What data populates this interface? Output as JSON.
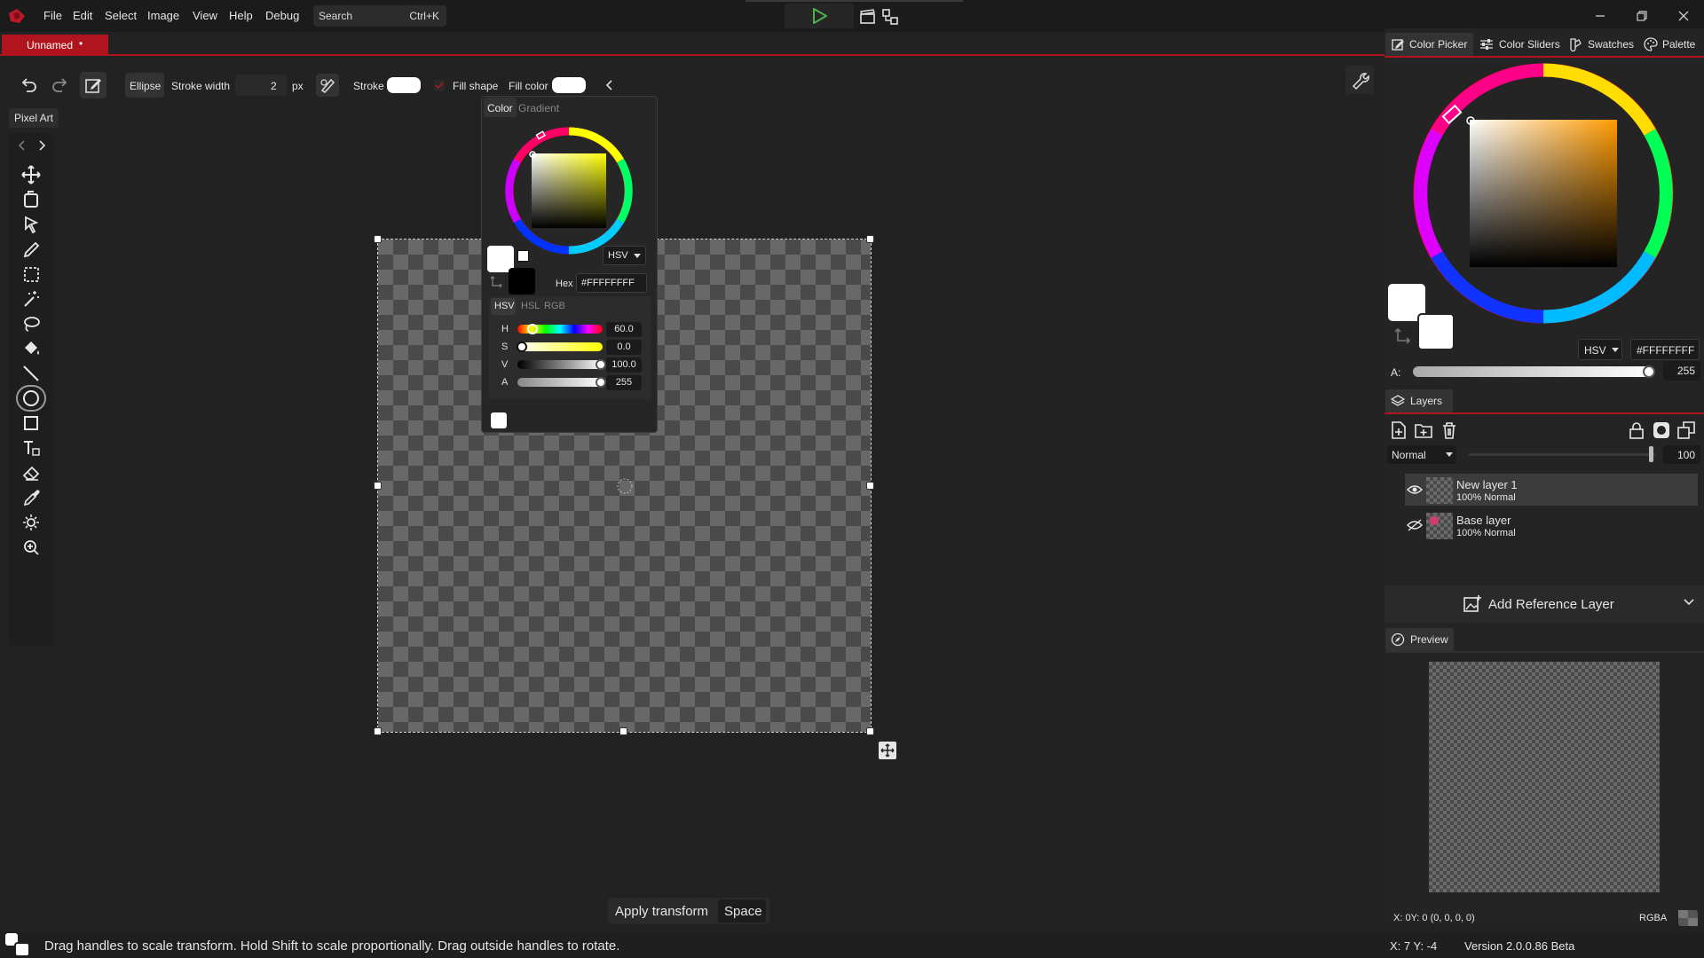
{
  "menu": {
    "items": [
      "File",
      "Edit",
      "Select",
      "Image",
      "View",
      "Help",
      "Debug"
    ],
    "search_placeholder": "Search",
    "search_shortcut": "Ctrl+K"
  },
  "document": {
    "tab_name": "Unnamed",
    "unsaved_mark": "•"
  },
  "toolbar": {
    "shape_label": "Ellipse",
    "stroke_width_label": "Stroke width",
    "stroke_width_value": "2",
    "stroke_width_unit": "px",
    "stroke_label": "Stroke",
    "fill_shape_label": "Fill shape",
    "fill_color_label": "Fill color"
  },
  "tools": {
    "palette_name": "Pixel Art"
  },
  "popup": {
    "tab_color": "Color",
    "tab_gradient": "Gradient",
    "mode": "HSV",
    "hex_label": "Hex",
    "hex_value": "#FFFFFFFF",
    "subtabs": [
      "HSV",
      "HSL",
      "RGB"
    ],
    "sliders": [
      {
        "label": "H",
        "value": "60.0",
        "fraction": 0.167
      },
      {
        "label": "S",
        "value": "0.0",
        "fraction": 0.0
      },
      {
        "label": "V",
        "value": "100.0",
        "fraction": 1.0
      },
      {
        "label": "A",
        "value": "255",
        "fraction": 1.0
      }
    ]
  },
  "right_panel": {
    "tabs": [
      "Color Picker",
      "Color Sliders",
      "Swatches",
      "Palette"
    ],
    "mode": "HSV",
    "hex_value": "#FFFFFFFF",
    "alpha_label": "A:",
    "alpha_value": "255",
    "layers_title": "Layers",
    "blend_mode": "Normal",
    "opacity": "100",
    "layers": [
      {
        "name": "New layer 1",
        "info": "100%  Normal",
        "visible": true,
        "selected": true
      },
      {
        "name": "Base layer",
        "info": "100%  Normal",
        "visible": false,
        "selected": false
      }
    ],
    "add_reference": "Add Reference Layer",
    "preview_title": "Preview",
    "coords": "X: 0Y: 0   (0, 0, 0, 0)",
    "format": "RGBA"
  },
  "apply": {
    "label": "Apply transform",
    "shortcut": "Space"
  },
  "status": {
    "hint": "Drag handles to scale transform. Hold Shift to scale proportionally. Drag outside handles to rotate.",
    "cursor": "X: 7 Y: -4",
    "version": "Version 2.0.0.86 Beta"
  },
  "colors": {
    "accent": "#b0141f",
    "panel": "#242424",
    "background": "#222222",
    "play": "#4caf50"
  }
}
